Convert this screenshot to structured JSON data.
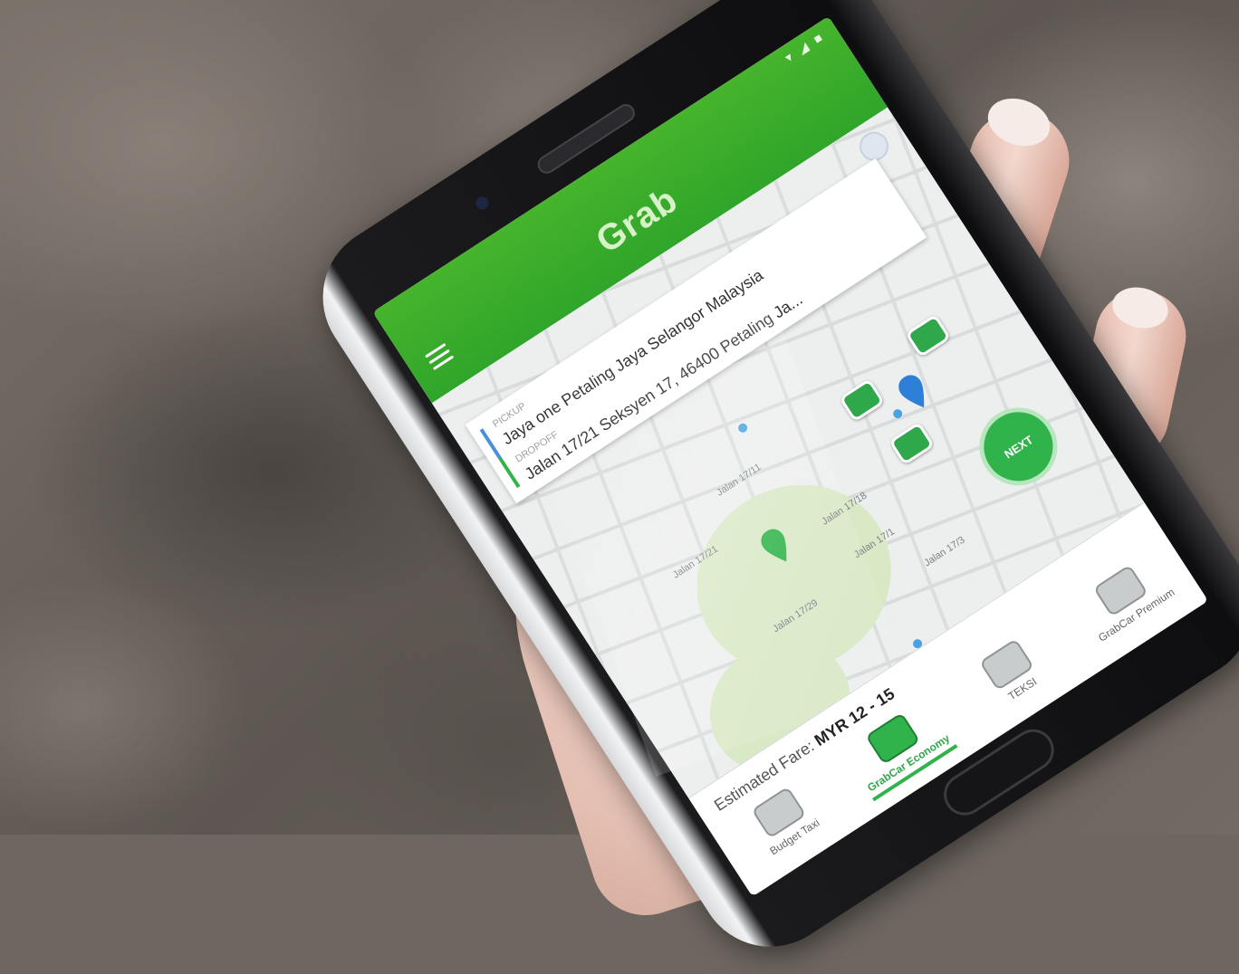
{
  "app": {
    "brand": "Grab",
    "status_icons": "▾ ◢ ■"
  },
  "address": {
    "pickup_label": "PICKUP",
    "pickup_text": "Jaya one Petaling Jaya Selangor Malaysia",
    "dropoff_label": "DROPOFF",
    "dropoff_text": "Jalan 17/21 Seksyen 17, 46400 Petaling Ja..."
  },
  "map": {
    "road_labels": [
      "Jalan 17/21",
      "Jalan 17/11",
      "Jalan 17/18",
      "Jalan 17/1",
      "Jalan 17/29",
      "Jalan 17/3"
    ]
  },
  "actions": {
    "next_label": "NEXT"
  },
  "fare": {
    "prefix": "Estimated Fare:",
    "value": "MYR 12 - 15"
  },
  "ride_options": [
    {
      "label": "Budget Taxi",
      "active": false
    },
    {
      "label": "GrabCar Economy",
      "active": true
    },
    {
      "label": "TEKSI",
      "active": false
    },
    {
      "label": "GrabCar Premium",
      "active": false
    }
  ],
  "colors": {
    "brand_green": "#2fa52a",
    "accent_blue": "#4a90d9"
  }
}
